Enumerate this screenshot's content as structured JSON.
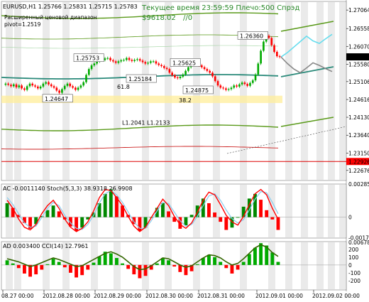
{
  "header": {
    "symbol_ohlc": "EURUSD,H1  1.25766  1.25831  1.25715  1.25783",
    "indicator_line1": "Расширенный ценовой диапазон",
    "indicator_line2": "pivot=1.2519",
    "server_time": "Текущее время 23:59:59 Плечо:500 Спрэд",
    "balance": "$9618.02",
    "balance_suffix": "//0"
  },
  "colors": {
    "background": "#ffffff",
    "bull_candle": "#00aa00",
    "bear_candle": "#ff0000",
    "trend_channel": "#5a9a1a",
    "moving_average": "#2a8a7a",
    "forecast_bull": "#66ddee",
    "forecast_bear": "#888888",
    "support_line": "#dd0000",
    "stoch_main": "#ff0000",
    "stoch_signal": "#88ccee",
    "ac_hist_up": "#008800",
    "ac_hist_down": "#ff0000",
    "ad_line": "#336600",
    "cci_hist_up": "#00aa00",
    "cci_hist_down": "#ff0000",
    "zone_fill": "#ffee99",
    "price_tag_current": "#000000",
    "price_tag_support": "#ff0000"
  },
  "chart_data": [
    {
      "type": "line",
      "title": "EURUSD,H1",
      "panel": "price",
      "ylim": [
        1.224,
        1.273
      ],
      "y_ticks": [
        "1.27064",
        "1.26558",
        "1.26070",
        "1.25580",
        "1.25106",
        "1.24616",
        "1.24130",
        "1.23640",
        "1.23150",
        "1.22926",
        "1.22676"
      ],
      "current_price_tag": "1.25783",
      "support_tag": "1.22926",
      "level_labels": [
        {
          "text": "1.26360",
          "price": 1.2636
        },
        {
          "text": "1.25753",
          "price": 1.2575
        },
        {
          "text": "1.25625",
          "price": 1.2562
        },
        {
          "text": "1.25184",
          "price": 1.2518
        },
        {
          "text": "1.24875",
          "price": 1.2487
        },
        {
          "text": "1.24647",
          "price": 1.2464
        }
      ],
      "fib_labels": [
        {
          "text": "61.8",
          "price": 1.2497
        },
        {
          "text": "38.2",
          "price": 1.246
        }
      ],
      "trend_label": "L1.2041 L1.2133",
      "zone": {
        "low": 1.2452,
        "high": 1.2472
      },
      "support_level": 1.2292,
      "x_ticks": [
        "08.27 00:00",
        "2012.08.28 00:00",
        "2012.08.29 00:00",
        "2012.08.30 00:00",
        "2012.08.31 00:00",
        "2012.09.01 00:00",
        "2012.09.02 00:00"
      ],
      "close_series": [
        1.2505,
        1.2502,
        1.2498,
        1.2503,
        1.2495,
        1.25,
        1.2492,
        1.2488,
        1.2498,
        1.2505,
        1.25,
        1.2497,
        1.2492,
        1.2497,
        1.2505,
        1.2509,
        1.2503,
        1.2498,
        1.2494,
        1.2486,
        1.248,
        1.249,
        1.2499,
        1.2505,
        1.2498,
        1.2494,
        1.2488,
        1.2494,
        1.25,
        1.2509,
        1.2529,
        1.2545,
        1.2555,
        1.256,
        1.2566,
        1.2572,
        1.257,
        1.2574,
        1.2575,
        1.2569,
        1.2566,
        1.2562,
        1.2566,
        1.2569,
        1.257,
        1.2575,
        1.257,
        1.2567,
        1.257,
        1.2572,
        1.2568,
        1.2564,
        1.256,
        1.2562,
        1.2566,
        1.2566,
        1.256,
        1.2556,
        1.2553,
        1.2548,
        1.2545,
        1.2535,
        1.2528,
        1.2522,
        1.252,
        1.2524,
        1.253,
        1.254,
        1.255,
        1.2558,
        1.2562,
        1.256,
        1.2555,
        1.255,
        1.2545,
        1.254,
        1.2535,
        1.2525,
        1.2512,
        1.25,
        1.2494,
        1.2492,
        1.2488,
        1.249,
        1.2494,
        1.25,
        1.2497,
        1.2503,
        1.2508,
        1.2504,
        1.2499,
        1.2507,
        1.2514,
        1.253,
        1.256,
        1.2595,
        1.262,
        1.2636,
        1.263,
        1.261,
        1.2592,
        1.258,
        1.2578
      ],
      "forecast": {
        "bull": [
          1.2578,
          1.259,
          1.2605,
          1.262,
          1.2635,
          1.2622,
          1.2615,
          1.2628,
          1.264
        ],
        "bear": [
          1.2578,
          1.256,
          1.2545,
          1.2535,
          1.2548,
          1.2562,
          1.2555,
          1.2546,
          1.2538
        ]
      },
      "legend": "none",
      "grid": false
    },
    {
      "type": "bar",
      "title": "AC -0.0011140  Stoch(5,3,3) 38.9318 26.9908",
      "panel": "oscillator",
      "ylim": [
        -0.0018,
        0.00285
      ],
      "y_ticks": [
        "0.002850",
        "0",
        "-0.00177"
      ],
      "series": [
        {
          "name": "AC",
          "values": [
            0.0012,
            0.0008,
            0.0002,
            -0.0005,
            -0.001,
            -0.0006,
            0.0001,
            0.0006,
            0.001,
            0.0005,
            -0.0002,
            -0.0008,
            -0.0012,
            -0.0009,
            -0.0002,
            0.0004,
            0.0012,
            0.002,
            0.0024,
            0.0018,
            0.001,
            0.0002,
            -0.0006,
            -0.0012,
            -0.0009,
            0.0,
            0.0008,
            0.0012,
            0.0005,
            -0.0004,
            -0.001,
            -0.0007,
            0.0002,
            0.001,
            0.0016,
            0.0012,
            0.0004,
            -0.0004,
            -0.0011,
            -0.0009,
            0.0,
            0.0009,
            0.0016,
            0.002,
            0.0015,
            0.0006,
            -0.0002,
            -0.0011
          ]
        },
        {
          "name": "Stoch main",
          "values": [
            70,
            55,
            35,
            20,
            15,
            25,
            45,
            60,
            70,
            55,
            35,
            20,
            12,
            18,
            30,
            50,
            75,
            90,
            88,
            75,
            60,
            40,
            22,
            12,
            20,
            38,
            55,
            72,
            60,
            40,
            25,
            18,
            28,
            48,
            70,
            85,
            80,
            62,
            42,
            30,
            24,
            40,
            62,
            82,
            90,
            80,
            55,
            35
          ]
        },
        {
          "name": "Stoch signal",
          "values": [
            75,
            62,
            45,
            28,
            20,
            22,
            38,
            55,
            66,
            60,
            42,
            28,
            18,
            16,
            25,
            42,
            65,
            82,
            88,
            80,
            66,
            48,
            30,
            18,
            18,
            32,
            50,
            66,
            64,
            48,
            32,
            22,
            25,
            40,
            60,
            78,
            82,
            70,
            52,
            36,
            28,
            34,
            52,
            72,
            86,
            84,
            66,
            45
          ]
        }
      ]
    },
    {
      "type": "bar",
      "title": "AD 0.003400  CCI(14) 12.7961",
      "panel": "oscillator",
      "ylim": [
        -320,
        300
      ],
      "y_ticks": [
        "0.006783",
        "200",
        "100",
        "0",
        "-100",
        "-200"
      ],
      "series": [
        {
          "name": "CCI",
          "values": [
            60,
            20,
            -40,
            -110,
            -150,
            -120,
            -60,
            10,
            80,
            40,
            -30,
            -100,
            -160,
            -130,
            -60,
            30,
            110,
            170,
            150,
            90,
            20,
            -50,
            -120,
            -170,
            -140,
            -60,
            20,
            90,
            60,
            -20,
            -90,
            -130,
            -80,
            10,
            90,
            130,
            100,
            40,
            -40,
            -110,
            -60,
            40,
            140,
            220,
            280,
            250,
            160,
            40
          ]
        },
        {
          "name": "AD",
          "values": [
            80,
            60,
            40,
            10,
            -20,
            0,
            30,
            60,
            90,
            70,
            40,
            10,
            -20,
            -10,
            30,
            70,
            110,
            150,
            170,
            140,
            100,
            40,
            -20,
            -60,
            -50,
            -10,
            40,
            90,
            80,
            40,
            0,
            -30,
            -10,
            40,
            90,
            130,
            120,
            90,
            40,
            0,
            20,
            80,
            150,
            220,
            260,
            230,
            160,
            110
          ]
        }
      ]
    }
  ]
}
